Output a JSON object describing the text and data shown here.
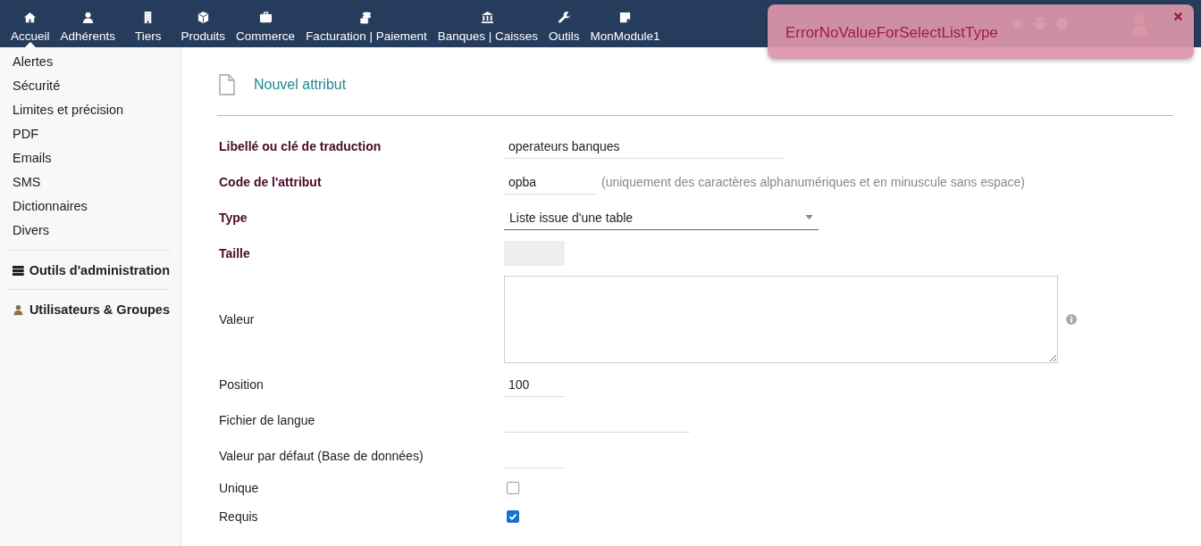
{
  "top_nav": {
    "items": [
      {
        "label": "Accueil",
        "selected": true
      },
      {
        "label": "Adhérents",
        "selected": false
      },
      {
        "label": "Tiers",
        "selected": false
      },
      {
        "label": "Produits",
        "selected": false
      },
      {
        "label": "Commerce",
        "selected": false
      },
      {
        "label": "Facturation | Paiement",
        "selected": false
      },
      {
        "label": "Banques | Caisses",
        "selected": false
      },
      {
        "label": "Outils",
        "selected": false
      },
      {
        "label": "MonModule1",
        "selected": false
      }
    ]
  },
  "sidebar": {
    "items": [
      "Alertes",
      "Sécurité",
      "Limites et précision",
      "PDF",
      "Emails",
      "SMS",
      "Dictionnaires",
      "Divers"
    ],
    "sections": [
      "Outils d'administration",
      "Utilisateurs & Groupes"
    ]
  },
  "page": {
    "title": "Nouvel attribut"
  },
  "form": [
    {
      "label": "Libellé ou clé de traduction",
      "required": true,
      "kind": "text",
      "value": "operateurs banques"
    },
    {
      "label": "Code de l'attribut",
      "required": true,
      "kind": "text",
      "value": "opba",
      "hint": "(uniquement des caractères alphanumériques et en minuscule sans espace)"
    },
    {
      "label": "Type",
      "required": true,
      "kind": "select",
      "value": "Liste issue d'une table"
    },
    {
      "label": "Taille",
      "required": true,
      "kind": "disabled"
    },
    {
      "label": "Valeur",
      "required": false,
      "kind": "textarea"
    },
    {
      "label": "Position",
      "required": false,
      "kind": "text",
      "value": "100"
    },
    {
      "label": "Fichier de langue",
      "required": false,
      "kind": "text"
    },
    {
      "label": "Valeur par défaut (Base de données)",
      "required": false,
      "kind": "text"
    },
    {
      "label": "Unique",
      "required": false,
      "kind": "checkbox",
      "checked": false
    },
    {
      "label": "Requis",
      "required": false,
      "kind": "checkbox",
      "checked": true
    }
  ],
  "error_toast": {
    "message": "ErrorNoValueForSelectListType"
  }
}
